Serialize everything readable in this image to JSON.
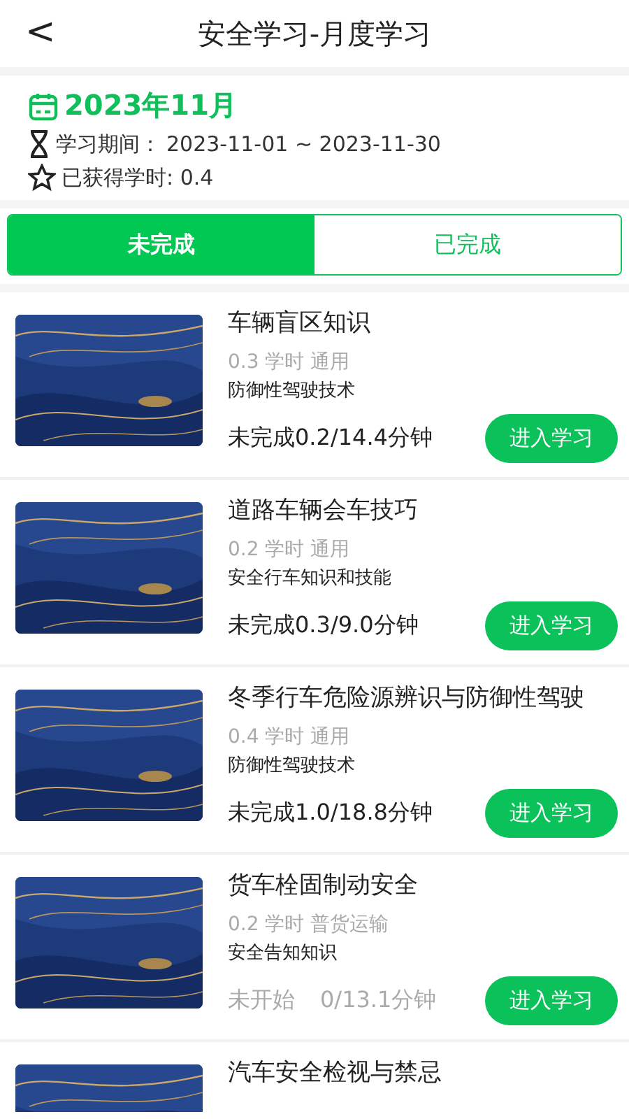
{
  "header": {
    "back": "<",
    "title": "安全学习-月度学习"
  },
  "summary": {
    "month": "2023年11月",
    "period_label": "学习期间：",
    "period": "2023-11-01 ~ 2023-11-30",
    "hours": "已获得学时: 0.4"
  },
  "tabs": [
    {
      "label": "未完成",
      "selected": true
    },
    {
      "label": "已完成",
      "selected": false
    }
  ],
  "courses": [
    {
      "kind": "in_progress",
      "title": "车辆盲区知识",
      "meta": "0.3 学时 通用",
      "category": "防御性驾驶技术",
      "status": "未完成0.2/14.4分钟",
      "button": "进入学习"
    },
    {
      "kind": "in_progress",
      "title": "道路车辆会车技巧",
      "meta": "0.2 学时 通用",
      "category": "安全行车知识和技能",
      "status": "未完成0.3/9.0分钟",
      "button": "进入学习"
    },
    {
      "kind": "in_progress",
      "title": "冬季行车危险源辨识与防御性驾驶",
      "meta": "0.4 学时 通用",
      "category": "防御性驾驶技术",
      "status": "未完成1.0/18.8分钟",
      "button": "进入学习"
    },
    {
      "kind": "not_started",
      "title": "货车栓固制动安全",
      "meta": "0.2 学时 普货运输",
      "category": "安全告知知识",
      "status": "未开始",
      "duration": "0/13.1分钟",
      "button": "进入学习"
    },
    {
      "kind": "partial",
      "title": "汽车安全检视与禁忌"
    }
  ]
}
